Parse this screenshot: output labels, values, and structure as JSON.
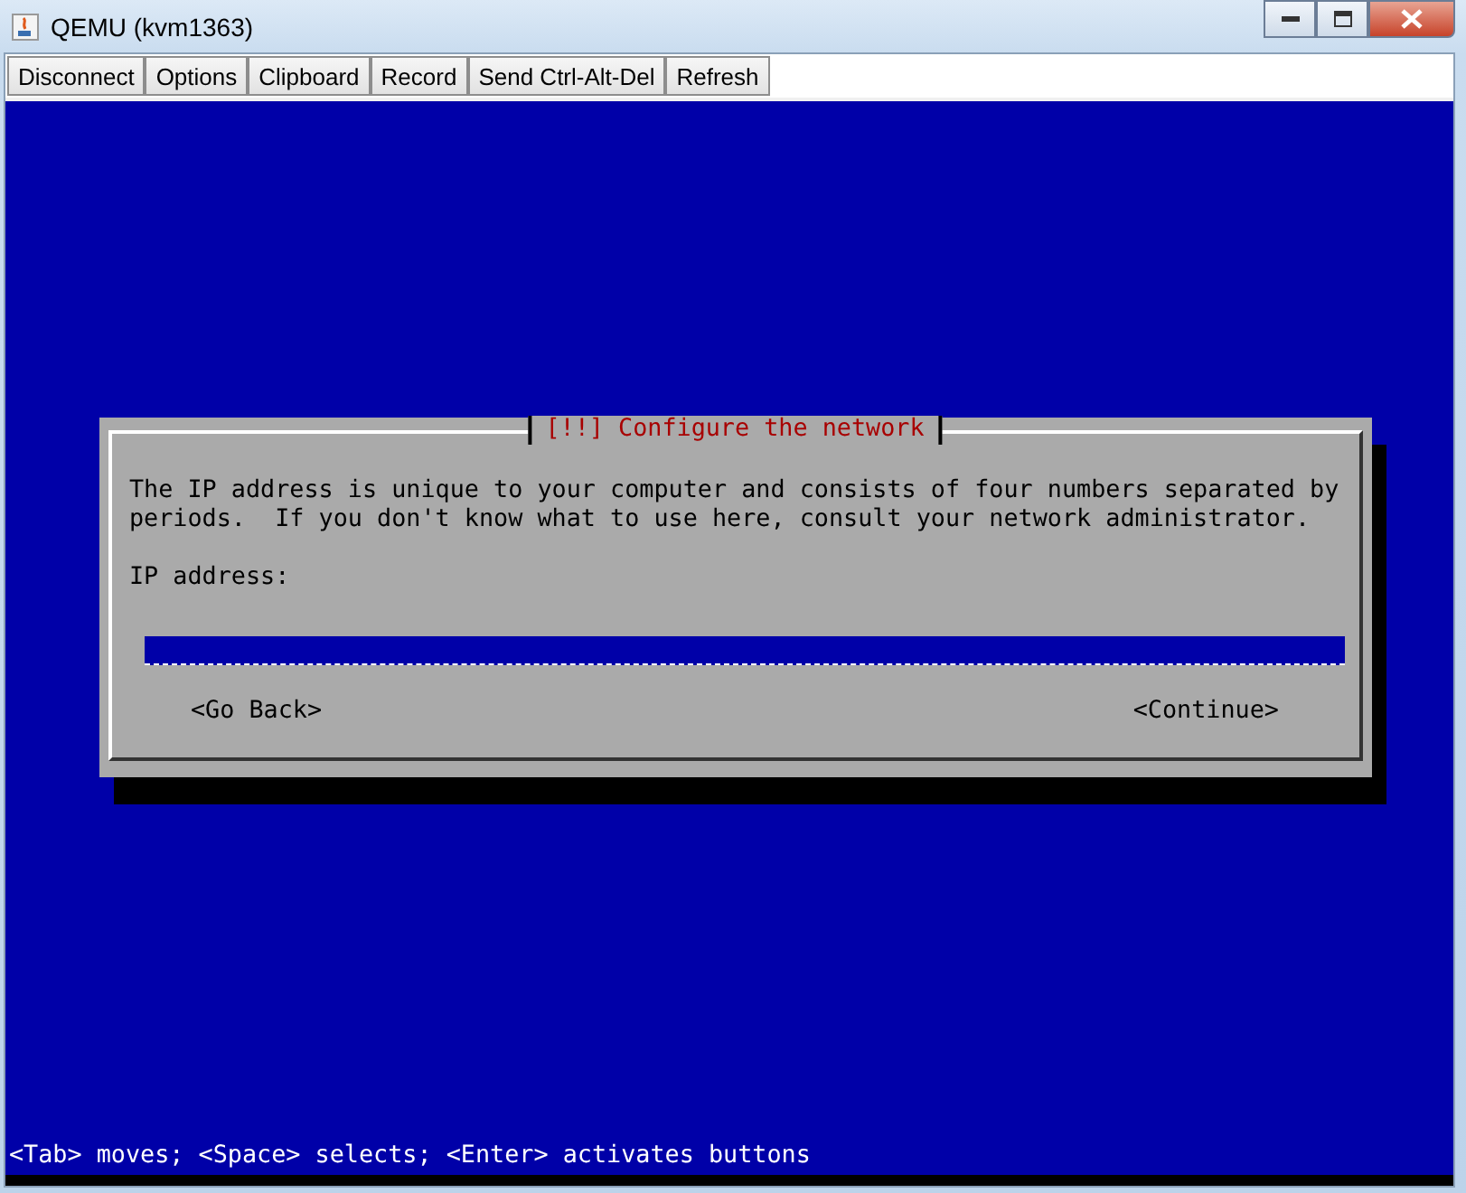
{
  "window": {
    "title": "QEMU (kvm1363)"
  },
  "toolbar": [
    "Disconnect",
    "Options",
    "Clipboard",
    "Record",
    "Send Ctrl-Alt-Del",
    "Refresh"
  ],
  "dialog": {
    "title": "[!!] Configure the network",
    "description": "The IP address is unique to your computer and consists of four numbers separated by periods.  If you don't know what to use here, consult your network administrator.",
    "field_label": "IP address:",
    "buttons": [
      "<Go Back>",
      "<Continue>"
    ]
  },
  "status_line": "<Tab> moves; <Space> selects; <Enter> activates buttons"
}
